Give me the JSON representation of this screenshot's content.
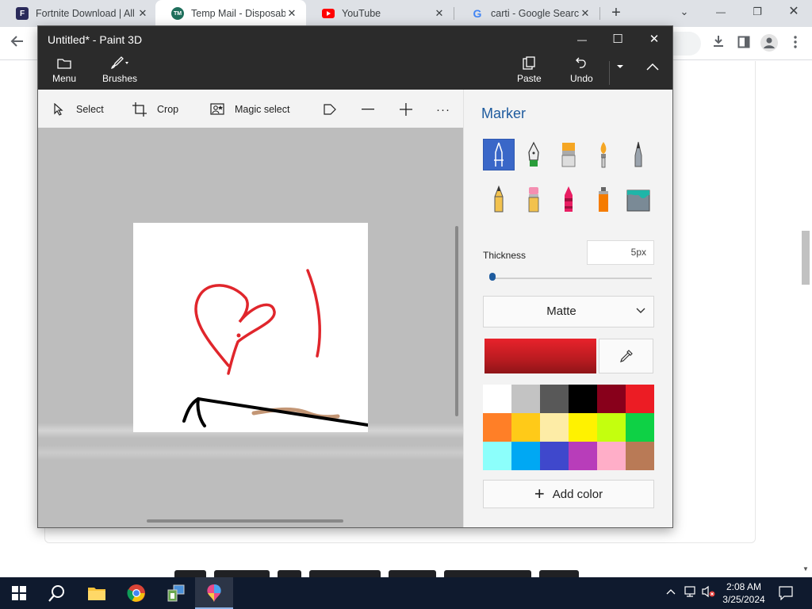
{
  "browser": {
    "tabs": [
      {
        "title": "Fortnite Download | All",
        "favicon": "fortnite-icon",
        "favicon_text": "F"
      },
      {
        "title": "Temp Mail - Disposable",
        "favicon": "tempmail-icon",
        "favicon_text": "TM"
      },
      {
        "title": "YouTube",
        "favicon": "youtube-icon"
      },
      {
        "title": "carti - Google Search",
        "favicon": "google-icon",
        "favicon_text": "G"
      }
    ],
    "new_tab": "+",
    "close_glyph": "✕",
    "window_controls": {
      "collapse": "⌄",
      "minimize": "—",
      "restore": "❐",
      "close": "✕"
    }
  },
  "paint3d": {
    "window_title": "Untitled* - Paint 3D",
    "window_controls": {
      "minimize": "—",
      "maximize": "☐",
      "close": "✕"
    },
    "ribbon": {
      "menu": "Menu",
      "brushes": "Brushes",
      "paste": "Paste",
      "undo": "Undo"
    },
    "tools": {
      "select": "Select",
      "crop": "Crop",
      "magic_select": "Magic select",
      "more": "···"
    },
    "panel": {
      "title": "Marker",
      "brushes": [
        "marker",
        "calligraphy-pen",
        "oil-brush",
        "watercolor",
        "pixel-pen",
        "pencil",
        "eraser",
        "crayon",
        "spray-can",
        "fill"
      ],
      "selected_brush": "marker",
      "thickness_label": "Thickness",
      "thickness_value": "5px",
      "thickness_level": 0.05,
      "finish": "Matte",
      "current_color": "#e8222b",
      "palette": [
        "#ffffff",
        "#c3c3c3",
        "#585858",
        "#000000",
        "#88001b",
        "#ec1c24",
        "#ff7f27",
        "#ffca18",
        "#fdeca6",
        "#fff200",
        "#c4ff0e",
        "#0ed145",
        "#8cfffb",
        "#00a8f3",
        "#3f48cc",
        "#b83dba",
        "#ffaec8",
        "#b97a56"
      ],
      "add_color": "Add color"
    }
  },
  "taskbar": {
    "time": "2:08 AM",
    "date": "3/25/2024"
  }
}
